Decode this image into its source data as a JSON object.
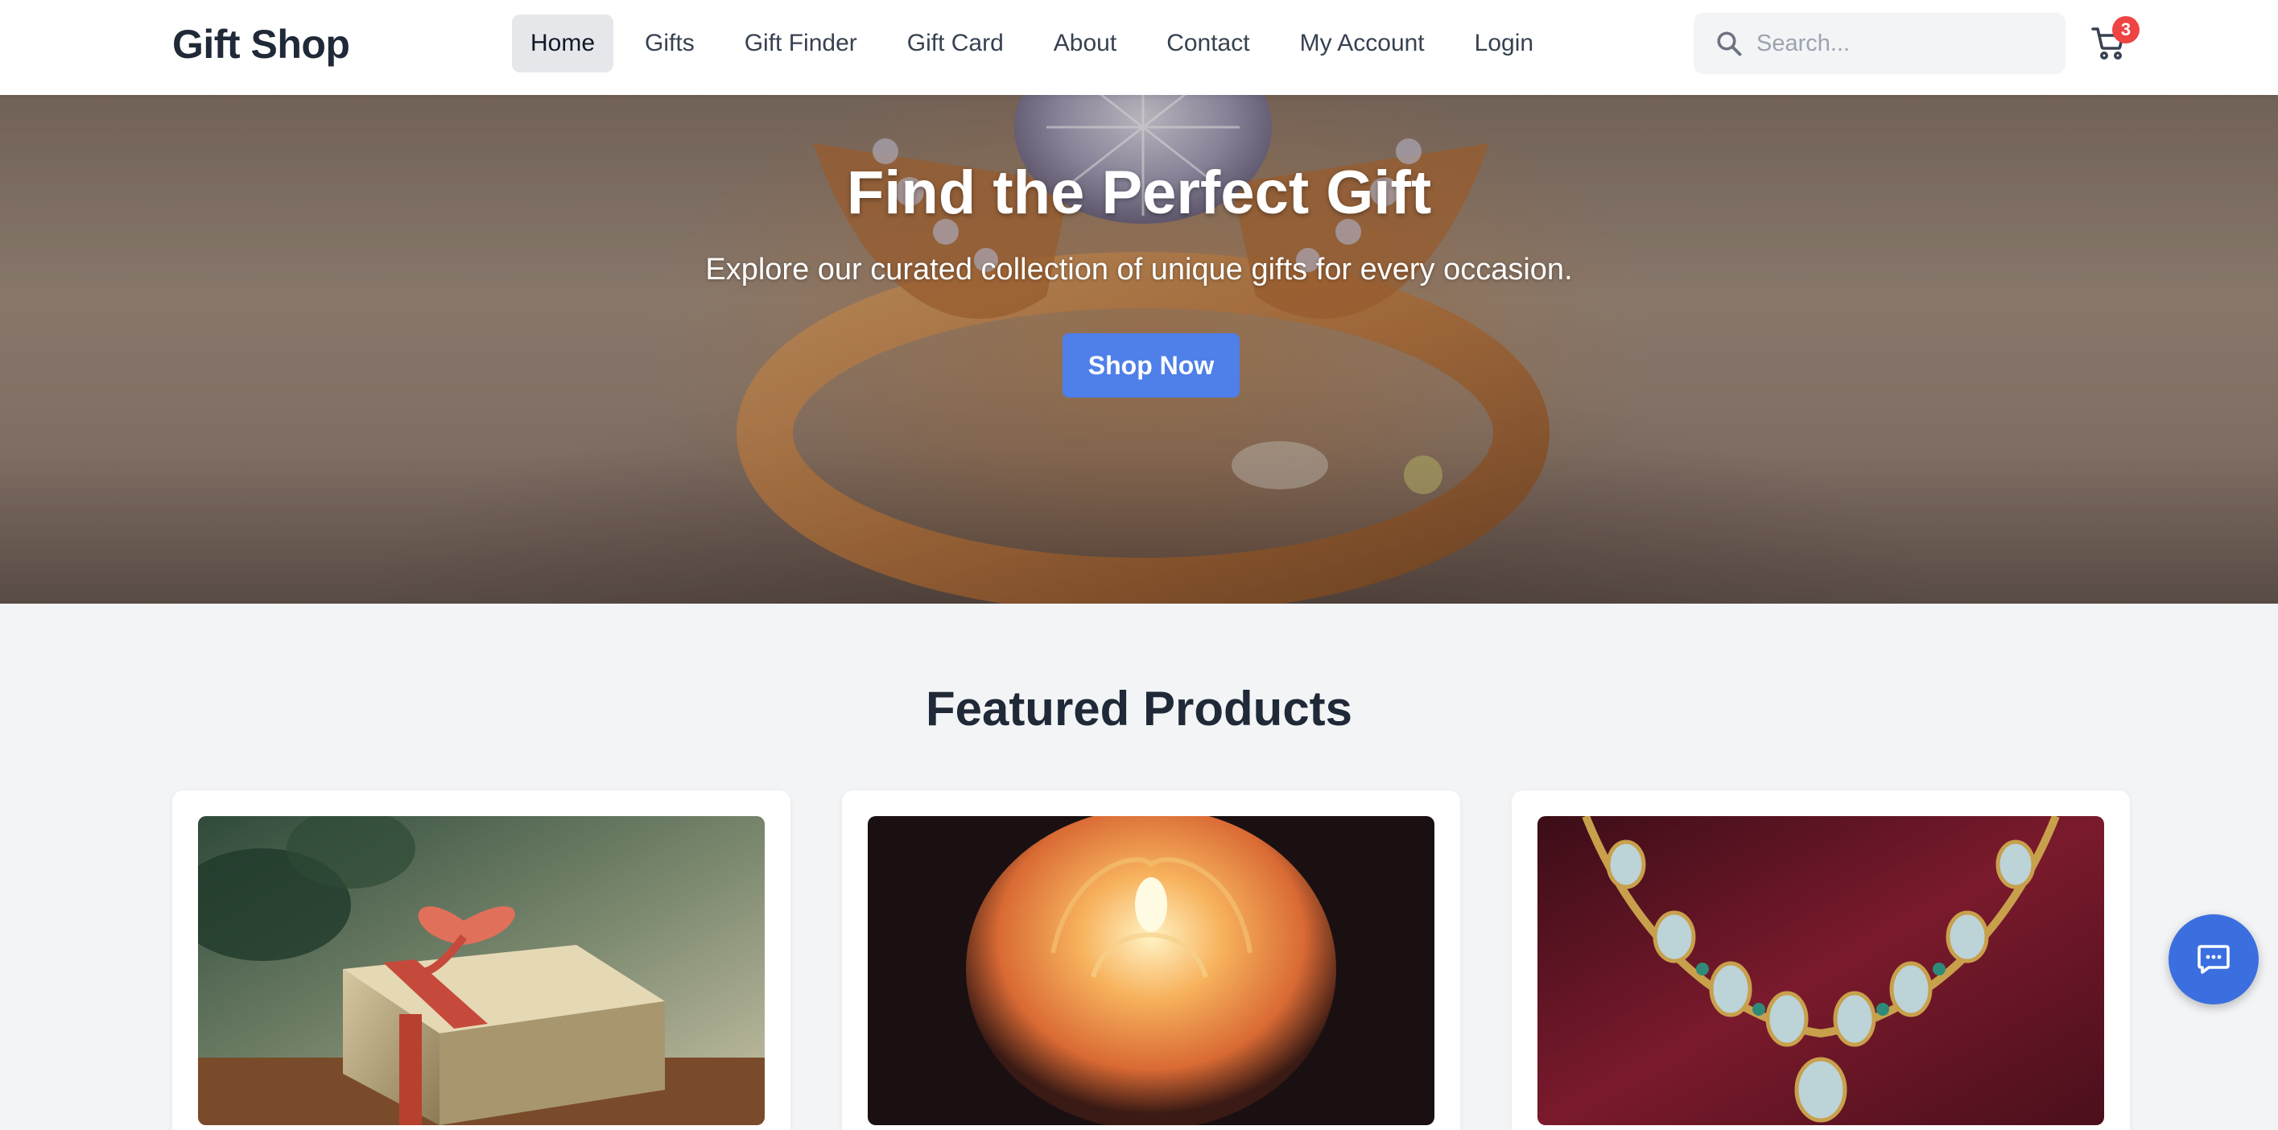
{
  "brand": {
    "name": "Gift Shop"
  },
  "nav": {
    "items": [
      {
        "label": "Home",
        "active": true
      },
      {
        "label": "Gifts"
      },
      {
        "label": "Gift Finder"
      },
      {
        "label": "Gift Card"
      },
      {
        "label": "About"
      },
      {
        "label": "Contact"
      },
      {
        "label": "My Account"
      },
      {
        "label": "Login"
      }
    ]
  },
  "search": {
    "placeholder": "Search...",
    "value": ""
  },
  "cart": {
    "count": "3",
    "icon": "cart-icon"
  },
  "hero": {
    "title": "Find the Perfect Gift",
    "subtitle": "Explore our curated collection of unique gifts for every occasion.",
    "cta": "Shop Now",
    "image": "jeweled-ring-photo"
  },
  "featured": {
    "title": "Featured Products",
    "products": [
      {
        "image": "wrapped-gift-box-photo"
      },
      {
        "image": "rose-candle-photo"
      },
      {
        "image": "jeweled-necklace-photo"
      }
    ]
  },
  "chat": {
    "icon": "chat-icon"
  },
  "colors": {
    "primary": "#4f7fe8",
    "chat": "#3b6fe0",
    "badge": "#ef4444",
    "page_bg": "#f3f4f6",
    "text": "#1f2937"
  }
}
